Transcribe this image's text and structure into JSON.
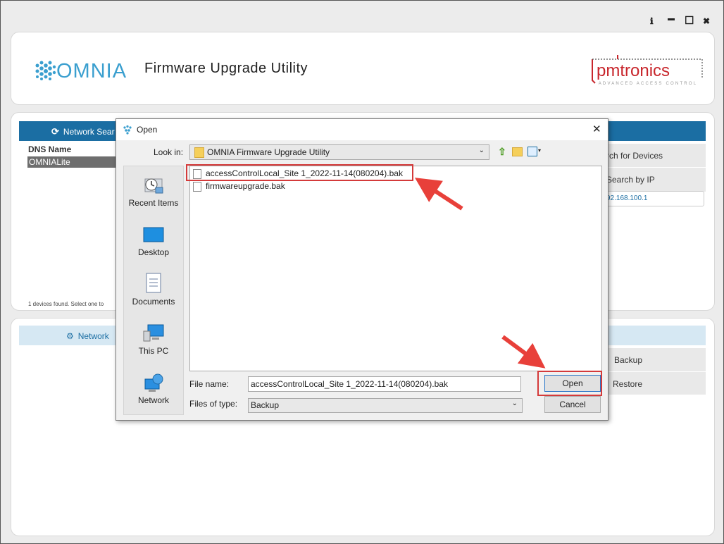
{
  "window": {
    "info_icon": "ℹ",
    "minimize_icon": "▬",
    "maximize_icon": "☐",
    "close_icon": "✖"
  },
  "header": {
    "brand": "OMNIA",
    "title": "Firmware Upgrade Utility",
    "pm_logo": "pmtronics",
    "pm_sub": "ADVANCED ACCESS CONTROL"
  },
  "network_panel": {
    "tab_label": "Network Sear",
    "column_header": "DNS Name",
    "selected_row": "OMNIALite",
    "status": "1 devices found. Select one to",
    "search_devices": "rch for Devices",
    "search_by_ip": "Search by IP",
    "ip_value": "92.168.100.1"
  },
  "lower_panel": {
    "tab_label": "Network",
    "backup_label": "Backup",
    "restore_label": "Restore"
  },
  "dialog": {
    "title": "Open",
    "close_icon": "✕",
    "look_in_label": "Look in:",
    "look_in_value": "OMNIA Firmware Upgrade Utility",
    "places": [
      {
        "label": "Recent Items",
        "icon": "recent-items-icon"
      },
      {
        "label": "Desktop",
        "icon": "desktop-icon"
      },
      {
        "label": "Documents",
        "icon": "documents-icon"
      },
      {
        "label": "This PC",
        "icon": "this-pc-icon"
      },
      {
        "label": "Network",
        "icon": "network-icon"
      }
    ],
    "files": [
      {
        "name": "accessControlLocal_Site 1_2022-11-14(080204).bak",
        "selected": true
      },
      {
        "name": "firmwareupgrade.bak",
        "selected": false
      }
    ],
    "file_name_label": "File name:",
    "file_name_value": "accessControlLocal_Site 1_2022-11-14(080204).bak",
    "files_of_type_label": "Files of type:",
    "files_of_type_value": "Backup",
    "open_button": "Open",
    "cancel_button": "Cancel"
  },
  "colors": {
    "accent": "#1b6ea3",
    "highlight": "#d43a3a",
    "brand": "#3a9fcf"
  }
}
